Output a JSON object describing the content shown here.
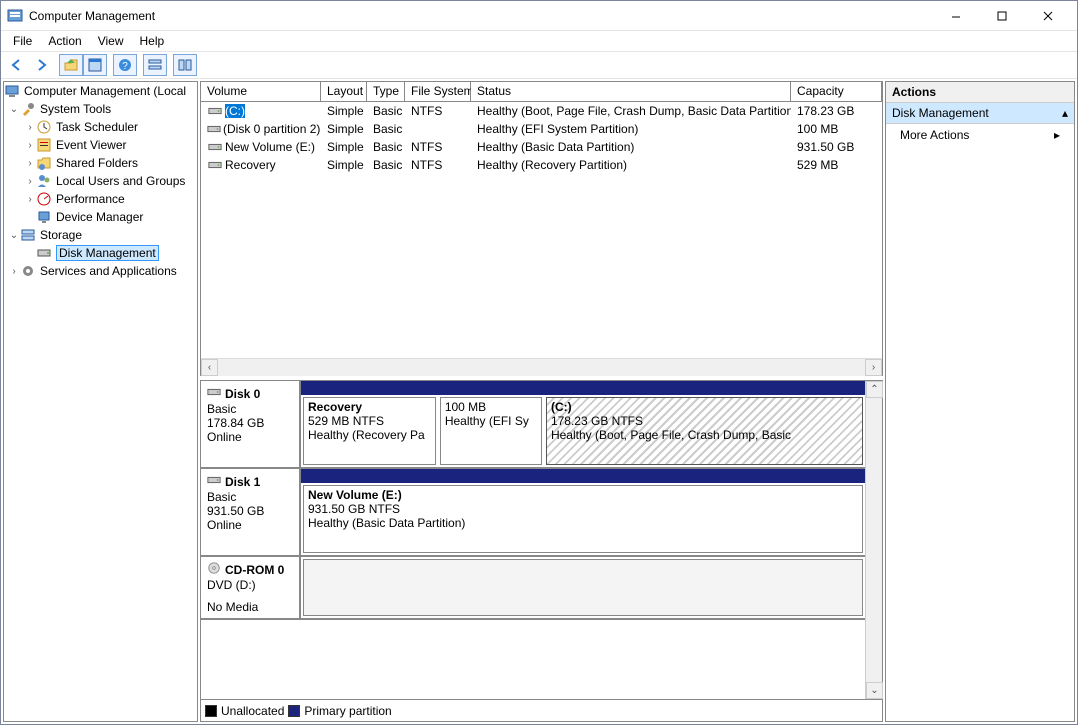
{
  "window": {
    "title": "Computer Management"
  },
  "menu": {
    "items": [
      "File",
      "Action",
      "View",
      "Help"
    ]
  },
  "tree": {
    "root": "Computer Management (Local",
    "system_tools": "System Tools",
    "task_scheduler": "Task Scheduler",
    "event_viewer": "Event Viewer",
    "shared_folders": "Shared Folders",
    "local_users": "Local Users and Groups",
    "performance": "Performance",
    "device_manager": "Device Manager",
    "storage": "Storage",
    "disk_management": "Disk Management",
    "services": "Services and Applications"
  },
  "vol_headers": {
    "volume": "Volume",
    "layout": "Layout",
    "type": "Type",
    "fs": "File System",
    "status": "Status",
    "capacity": "Capacity"
  },
  "volumes": [
    {
      "name": "(C:)",
      "layout": "Simple",
      "type": "Basic",
      "fs": "NTFS",
      "status": "Healthy (Boot, Page File, Crash Dump, Basic Data Partition)",
      "capacity": "178.23 GB",
      "selected": true
    },
    {
      "name": "(Disk 0 partition 2)",
      "layout": "Simple",
      "type": "Basic",
      "fs": "",
      "status": "Healthy (EFI System Partition)",
      "capacity": "100 MB",
      "selected": false
    },
    {
      "name": "New Volume (E:)",
      "layout": "Simple",
      "type": "Basic",
      "fs": "NTFS",
      "status": "Healthy (Basic Data Partition)",
      "capacity": "931.50 GB",
      "selected": false
    },
    {
      "name": "Recovery",
      "layout": "Simple",
      "type": "Basic",
      "fs": "NTFS",
      "status": "Healthy (Recovery Partition)",
      "capacity": "529 MB",
      "selected": false
    }
  ],
  "disks": [
    {
      "name": "Disk 0",
      "type": "Basic",
      "size": "178.84 GB",
      "state": "Online",
      "parts": [
        {
          "name": "Recovery",
          "size": "529 MB NTFS",
          "status": "Healthy (Recovery Pa",
          "flex": 1.2,
          "sel": false
        },
        {
          "name": "",
          "size": "100 MB",
          "status": "Healthy (EFI Sy",
          "flex": 0.9,
          "sel": false
        },
        {
          "name": "(C:)",
          "size": "178.23 GB NTFS",
          "status": "Healthy (Boot, Page File, Crash Dump, Basic",
          "flex": 3.0,
          "sel": true
        }
      ]
    },
    {
      "name": "Disk 1",
      "type": "Basic",
      "size": "931.50 GB",
      "state": "Online",
      "parts": [
        {
          "name": "New Volume  (E:)",
          "size": "931.50 GB NTFS",
          "status": "Healthy (Basic Data Partition)",
          "flex": 1,
          "sel": false
        }
      ]
    },
    {
      "name": "CD-ROM 0",
      "type": "DVD (D:)",
      "size": "",
      "state": "No Media",
      "parts": [
        {
          "name": "",
          "size": "",
          "status": "",
          "flex": 1,
          "sel": false,
          "empty": true
        }
      ]
    }
  ],
  "legend": {
    "unallocated": "Unallocated",
    "primary": "Primary partition"
  },
  "actions": {
    "header": "Actions",
    "group": "Disk Management",
    "more": "More Actions"
  }
}
